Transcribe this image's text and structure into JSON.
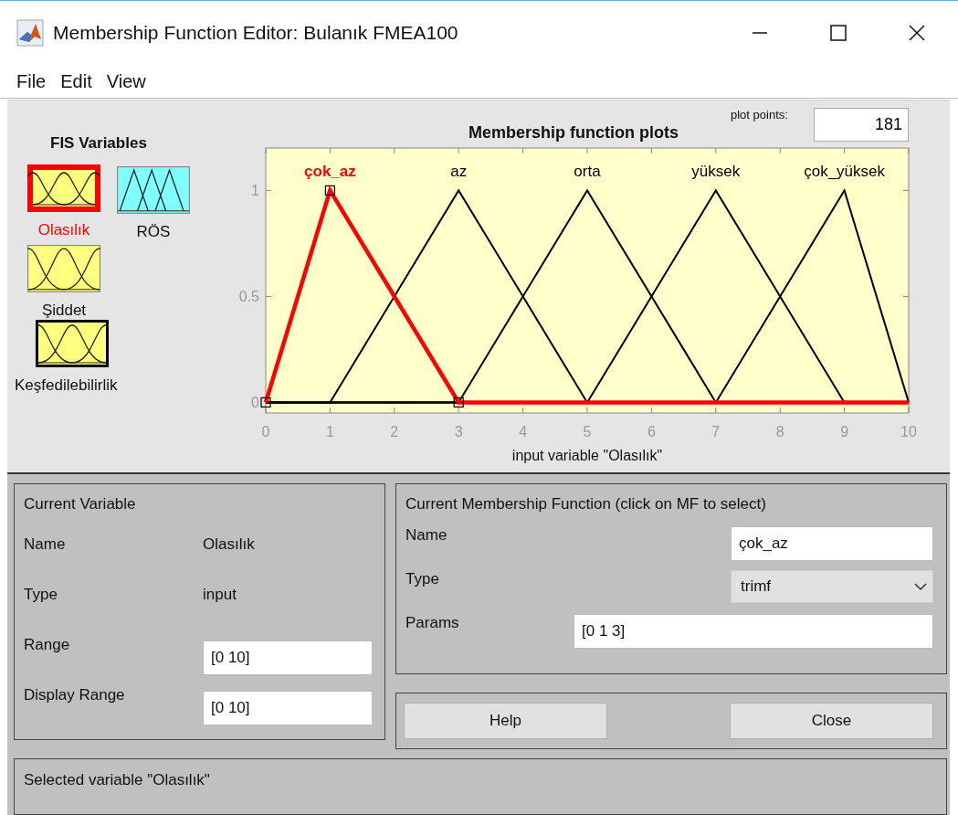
{
  "window": {
    "title": "Membership Function Editor: Bulanık FMEA100"
  },
  "menu": [
    "File",
    "Edit",
    "View"
  ],
  "fis_variables": {
    "title": "FIS Variables",
    "items": [
      {
        "label": "Olasılık",
        "color": "#ffff80",
        "selected": true,
        "focused": false
      },
      {
        "label": "RÖS",
        "color": "#80ffff",
        "selected": false,
        "focused": false
      },
      {
        "label": "Şiddet",
        "color": "#ffff80",
        "selected": false,
        "focused": false
      },
      {
        "label": "Keşfedilebilirlik",
        "color": "#ffff80",
        "selected": false,
        "focused": true
      }
    ]
  },
  "plot": {
    "plot_points_label": "plot points:",
    "plot_points": "181",
    "curves": [
      {
        "selected": true
      },
      {
        "selected": false
      },
      {
        "selected": false
      },
      {
        "selected": false
      },
      {
        "selected": false
      }
    ],
    "chart_data": {
      "type": "line",
      "title": "Membership function plots",
      "xlabel": "input variable \"Olasılık\"",
      "x": [
        0,
        1,
        3,
        5,
        7,
        9,
        10
      ],
      "xlim": [
        0,
        10
      ],
      "ylim": [
        -0.05,
        1.2
      ],
      "xticks": [
        0,
        1,
        2,
        3,
        4,
        5,
        6,
        7,
        8,
        9,
        10
      ],
      "yticks": [
        0,
        0.5,
        1
      ],
      "series": [
        {
          "name": "çok_az",
          "color": "#ff0000",
          "values": [
            0,
            1,
            0,
            0,
            0,
            0,
            0
          ]
        },
        {
          "name": "az",
          "color": "#000000",
          "values": [
            0,
            0,
            1,
            0,
            0,
            0,
            0
          ]
        },
        {
          "name": "orta",
          "color": "#000000",
          "values": [
            0,
            0,
            0,
            1,
            0,
            0,
            0
          ]
        },
        {
          "name": "yüksek",
          "color": "#000000",
          "values": [
            0,
            0,
            0,
            0,
            1,
            0,
            0
          ]
        },
        {
          "name": "çok_yüksek",
          "color": "#000000",
          "values": [
            0,
            0,
            0,
            0,
            0,
            1,
            0
          ]
        }
      ]
    }
  },
  "current_variable": {
    "title": "Current Variable",
    "rows": [
      {
        "label": "Name",
        "kind": "text",
        "value": "Olasılık"
      },
      {
        "label": "Type",
        "kind": "text",
        "value": "input"
      },
      {
        "label": "Range",
        "kind": "field",
        "value": "[0 10]"
      },
      {
        "label": "Display Range",
        "kind": "field",
        "value": "[0 10]"
      }
    ]
  },
  "current_mf": {
    "title": "Current Membership Function (click on MF to select)",
    "name_label": "Name",
    "name": "çok_az",
    "type_label": "Type",
    "type": "trimf",
    "params_label": "Params",
    "params": "[0 1 3]"
  },
  "buttons": [
    "Help",
    "Close"
  ],
  "status": "Selected variable \"Olasılık\""
}
